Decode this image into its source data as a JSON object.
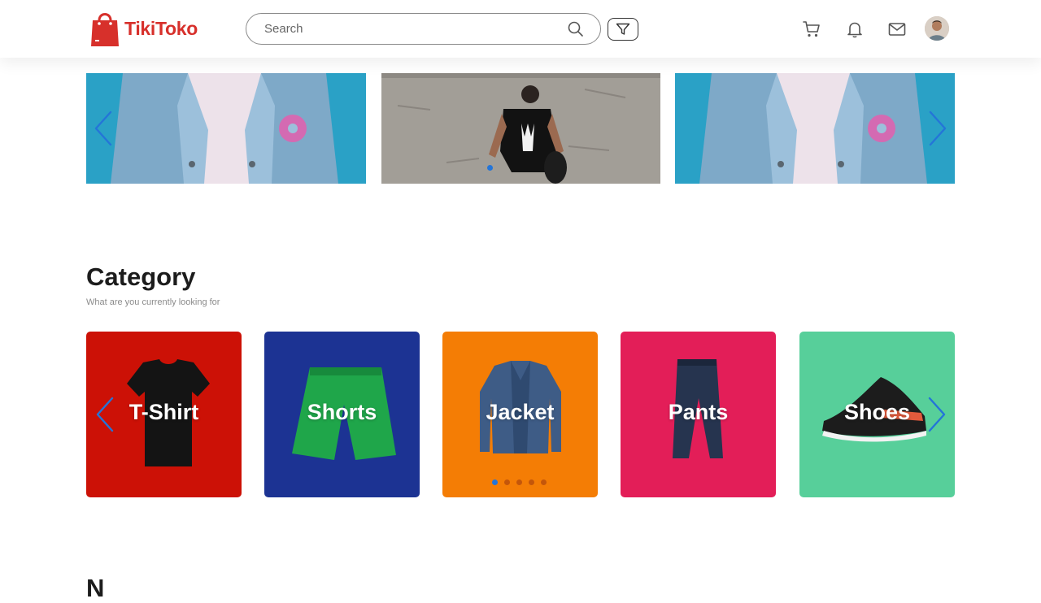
{
  "app": {
    "name": "TikiToko",
    "brand_color": "#d7302b"
  },
  "header": {
    "search_placeholder": "Search",
    "icons": [
      "search-icon",
      "filter-icon",
      "cart-icon",
      "bell-icon",
      "mail-icon",
      "avatar"
    ]
  },
  "banner": {
    "slides": [
      "denim-jacket-slide",
      "skeleton-tshirt-slide",
      "denim-jacket-slide"
    ],
    "active_index": 0,
    "accent": "#2475d8"
  },
  "category": {
    "title": "Category",
    "subtitle": "What are you currently looking for",
    "items": [
      {
        "label": "T-Shirt",
        "color": "#cc1106"
      },
      {
        "label": "Shorts",
        "color": "#1c3393"
      },
      {
        "label": "Jacket",
        "color": "#f47d05"
      },
      {
        "label": "Pants",
        "color": "#e31e58"
      },
      {
        "label": "Shoes",
        "color": "#57cf9a"
      }
    ],
    "pagination": {
      "count": 5,
      "active_index": 0
    }
  },
  "next_section": {
    "title_partial": "N"
  }
}
